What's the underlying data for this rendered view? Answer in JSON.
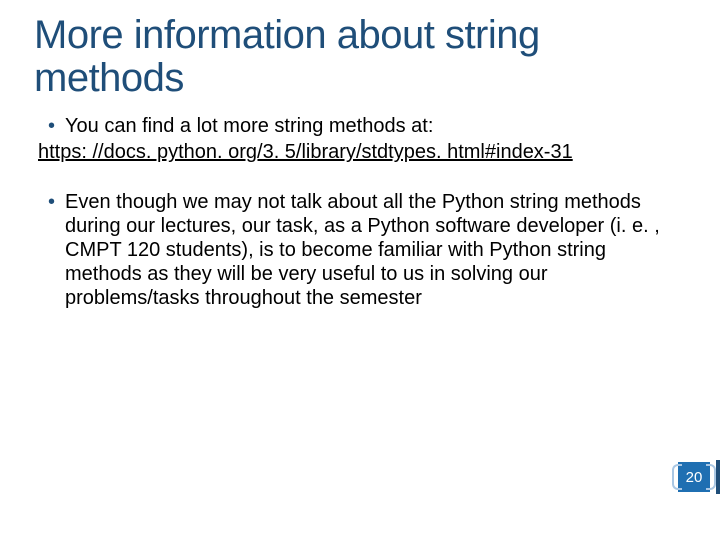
{
  "title": "More information about string methods",
  "bullet1": "You can find a lot more string methods at:",
  "link": "https: //docs. python. org/3. 5/library/stdtypes. html#index-31",
  "bullet2": "Even though we may not talk about all the Python string methods during our lectures, our task, as a Python software developer (i. e. , CMPT 120 students), is to become familiar with Python string methods as they will be very useful to us in solving our problems/tasks throughout the semester",
  "page_number": "20"
}
